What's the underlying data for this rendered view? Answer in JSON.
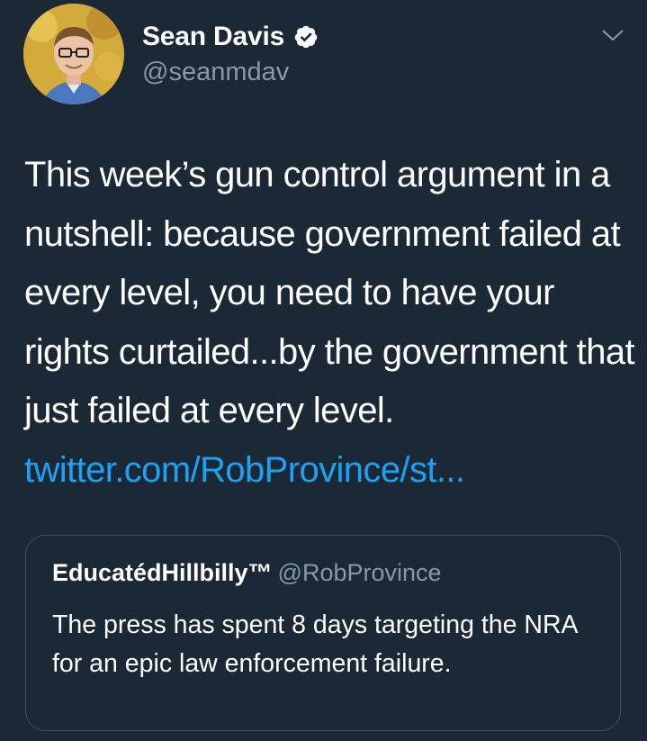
{
  "author": {
    "display_name": "Sean Davis",
    "handle": "@seanmdav",
    "verified": true
  },
  "tweet": {
    "text": "This week’s gun control argument in a nutshell: because government failed at every level, you need to have your rights curtailed...by the government that just failed at every level. ",
    "link_text": "twitter.com/RobProvince/st..."
  },
  "quoted_tweet": {
    "display_name": "EducatédHillbilly™",
    "handle": "@RobProvince",
    "text": "The press has spent 8 days targeting the NRA for an epic law enforcement failure."
  },
  "icons": {
    "verified": "verified-badge-icon",
    "menu": "chevron-down-icon"
  },
  "colors": {
    "background": "#1b2836",
    "text": "#ffffff",
    "secondary_text": "#8899a6",
    "link": "#1da1f2",
    "border": "#3d5466"
  }
}
